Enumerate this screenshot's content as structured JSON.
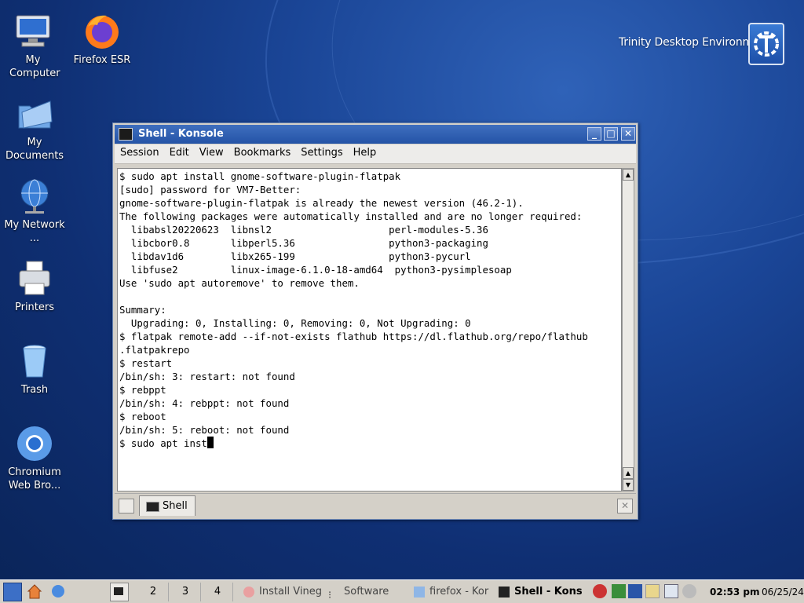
{
  "desktop": {
    "icons": [
      {
        "label": "My Computer"
      },
      {
        "label": "Firefox ESR"
      },
      {
        "label": "My Documents"
      },
      {
        "label": "My Network ..."
      },
      {
        "label": "Printers"
      },
      {
        "label": "Trash"
      },
      {
        "label": "Chromium Web Bro..."
      }
    ],
    "brand_text": "Trinity Desktop Environment"
  },
  "window": {
    "title": "Shell - Konsole",
    "menu": [
      "Session",
      "Edit",
      "View",
      "Bookmarks",
      "Settings",
      "Help"
    ],
    "terminal_lines": [
      "$ sudo apt install gnome-software-plugin-flatpak",
      "[sudo] password for VM7-Better:",
      "gnome-software-plugin-flatpak is already the newest version (46.2-1).",
      "The following packages were automatically installed and are no longer required:",
      "  libabsl20220623  libnsl2                    perl-modules-5.36",
      "  libcbor0.8       libperl5.36                python3-packaging",
      "  libdav1d6        libx265-199                python3-pycurl",
      "  libfuse2         linux-image-6.1.0-18-amd64  python3-pysimplesoap",
      "Use 'sudo apt autoremove' to remove them.",
      "",
      "Summary:",
      "  Upgrading: 0, Installing: 0, Removing: 0, Not Upgrading: 0",
      "$ flatpak remote-add --if-not-exists flathub https://dl.flathub.org/repo/flathub",
      ".flatpakrepo",
      "$ restart",
      "/bin/sh: 3: restart: not found",
      "$ rebppt",
      "/bin/sh: 4: rebppt: not found",
      "$ reboot",
      "/bin/sh: 5: reboot: not found"
    ],
    "prompt_line": "$ sudo apt inst",
    "tab_label": "Shell"
  },
  "taskbar": {
    "desktops": [
      "2",
      "3",
      "4"
    ],
    "tasks": [
      {
        "label": "Install Vineg",
        "active": false
      },
      {
        "label": "Software",
        "active": false
      },
      {
        "label": "firefox - Kor",
        "active": false
      },
      {
        "label": "Shell - Kons",
        "active": true
      }
    ],
    "time": "02:53 pm",
    "date": "06/25/24"
  },
  "colors": {
    "title_bar": "#2a5aab",
    "desktop_bg": "#1a4596",
    "panel": "#d4d0c8"
  }
}
